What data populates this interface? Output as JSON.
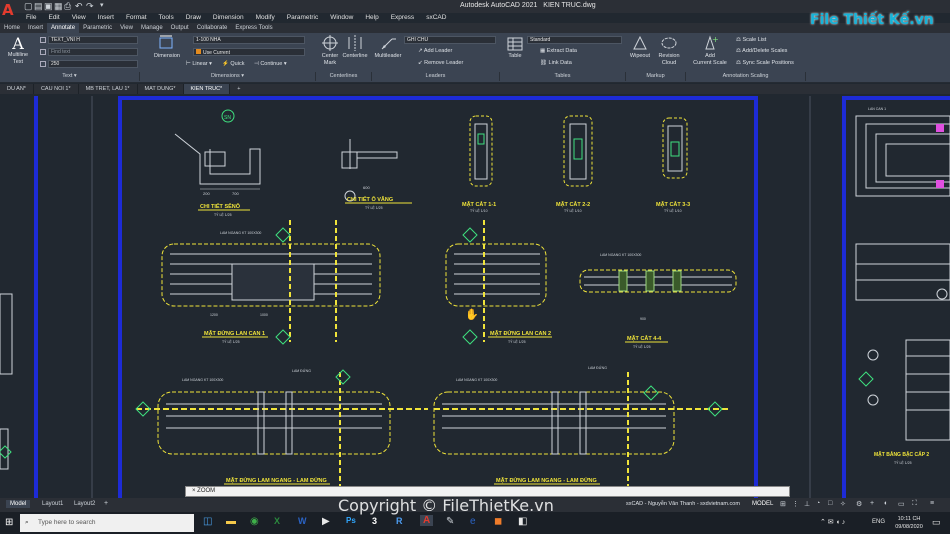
{
  "titlebar": {
    "app": "Autodesk AutoCAD 2021",
    "file": "KIEN TRUC.dwg"
  },
  "menu": [
    "File",
    "Edit",
    "View",
    "Insert",
    "Format",
    "Tools",
    "Draw",
    "Dimension",
    "Modify",
    "Parametric",
    "Window",
    "Help",
    "Express",
    "sxCAD"
  ],
  "ribbon_tabs": [
    "Home",
    "Insert",
    "Annotate",
    "Parametric",
    "View",
    "Manage",
    "Output",
    "Collaborate",
    "Express Tools"
  ],
  "ribbon_active_tab": "Annotate",
  "ribbon": {
    "multiline_text": "Multiline\nText",
    "text_style": "TEXT_VNI H",
    "find_text": "Find text",
    "text_height": "250",
    "text_group": "Text",
    "dimension": "Dimension",
    "dim_style": "1-100 NHA",
    "use_current": "Use Current",
    "linear": "Linear",
    "quick": "Quick",
    "continue": "Continue",
    "dimensions_group": "Dimensions",
    "center_mark": "Center\nMark",
    "centerline": "Centerline",
    "centerlines_group": "Centerlines",
    "multileader": "Multileader",
    "leader_style": "GHI CHU",
    "add_leader": "Add Leader",
    "remove_leader": "Remove Leader",
    "leaders_group": "Leaders",
    "table": "Table",
    "table_style": "Standard",
    "extract_data": "Extract Data",
    "link_data": "Link Data",
    "tables_group": "Tables",
    "wipeout": "Wipeout",
    "revision_cloud": "Revision\nCloud",
    "markup_group": "Markup",
    "add_current_scale": "Add\nCurrent Scale",
    "scale_list": "Scale List",
    "add_delete_scales": "Add/Delete Scales",
    "sync_scale_positions": "Sync Scale Positions",
    "annotation_scaling_group": "Annotation Scaling"
  },
  "doc_tabs": [
    "DU AN*",
    "CAU NOI 1*",
    "MB TRET, LAU 1*",
    "MAT DUNG*",
    "KIEN TRUC*"
  ],
  "active_doc": "KIEN TRUC*",
  "drawing": {
    "chi_tiet_se_no": "CHI TIẾT SÊNÔ",
    "chi_tiet_o_vang": "CHI TIẾT Ô VĂNG",
    "mat_cat_11": "MẶT CẮT 1-1",
    "mat_cat_22": "MẶT CẮT 2-2",
    "mat_cat_33": "MẶT CẮT 3-3",
    "mat_cat_44": "MẶT CẮT 4-4",
    "mat_dung_lan_can_1": "MẶT ĐỨNG LAN CAN 1",
    "mat_dung_lan_can_2": "MẶT ĐỨNG LAN CAN 2",
    "mat_dung_lam_1": "MẶT ĐỨNG LAM NGANG - LAM ĐỨNG",
    "mat_dung_lam_2": "MẶT ĐỨNG LAM NGANG - LAM ĐỨNG",
    "mat_bang_bac_cap": "MẶT BẰNG BẬC CẤP 2",
    "scale": "TỶ LỆ 1/25",
    "scale_10": "TỶ LỆ 1/10",
    "lam_ngang": "LAM NGANG KT 100X300",
    "lam_dung": "LAM ĐỨNG",
    "lan_can": "LAN CAN 1",
    "dim_100": "100",
    "dim_1000": "1000",
    "dim_1200": "1200",
    "dim_900": "900",
    "dim_200": "200",
    "dim_700": "700",
    "dim_600": "600"
  },
  "status": {
    "model_tab": "Model",
    "layout1": "Layout1",
    "layout2": "Layout2",
    "command": "ZOOM",
    "right_text": "sxCAD - Nguyễn Văn Thanh - sxdvietnam.com",
    "mode": "MODEL"
  },
  "taskbar": {
    "search": "Type here to search",
    "lang": "ENG",
    "time": "10:11 CH",
    "date": "09/08/2020"
  },
  "watermark": {
    "top": "File Thiết Kế.vn",
    "bottom": "Copyright © FileThietKe.vn"
  },
  "colors": {
    "bg": "#212830",
    "ribbon": "#3b4452",
    "title_yellow": "#f0e43a",
    "frame_blue": "#1d2bd6",
    "accent_red": "#e23b2e"
  }
}
